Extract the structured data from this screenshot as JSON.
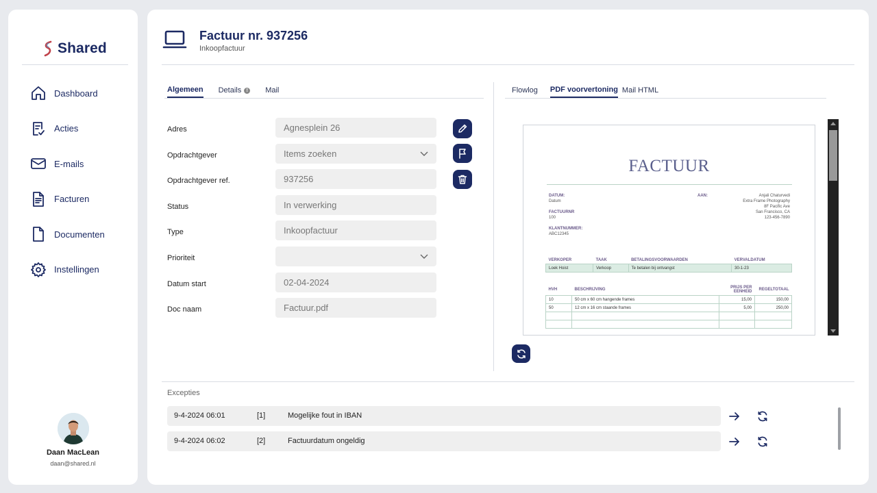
{
  "app": {
    "name": "Shared"
  },
  "sidebar": {
    "items": [
      {
        "label": "Dashboard",
        "icon": "home-icon"
      },
      {
        "label": "Acties",
        "icon": "tasks-icon"
      },
      {
        "label": "E-mails",
        "icon": "mail-icon"
      },
      {
        "label": "Facturen",
        "icon": "invoice-icon"
      },
      {
        "label": "Documenten",
        "icon": "document-icon"
      },
      {
        "label": "Instellingen",
        "icon": "gear-icon"
      }
    ],
    "user": {
      "name": "Daan MacLean",
      "email": "daan@shared.nl"
    }
  },
  "header": {
    "title": "Factuur nr. 937256",
    "subtitle": "Inkoopfactuur"
  },
  "left_tabs": [
    {
      "label": "Algemeen",
      "active": true
    },
    {
      "label": "Details",
      "active": false
    },
    {
      "label": "Mail",
      "active": false
    }
  ],
  "right_tabs": [
    {
      "label": "Flowlog",
      "active": false
    },
    {
      "label": "PDF voorvertoning",
      "active": true
    },
    {
      "label": "Mail HTML",
      "active": false
    }
  ],
  "form": {
    "fields": [
      {
        "label": "Adres",
        "value": "Agnesplein 26"
      },
      {
        "label": "Opdrachtgever",
        "value": "Items zoeken",
        "type": "select"
      },
      {
        "label": "Opdrachtgever ref.",
        "value": "937256"
      },
      {
        "label": "Status",
        "value": "In verwerking"
      },
      {
        "label": "Type",
        "value": "Inkoopfactuur"
      },
      {
        "label": "Prioriteit",
        "value": "",
        "type": "select"
      },
      {
        "label": "Datum start",
        "value": "02-04-2024"
      },
      {
        "label": "Doc naam",
        "value": "Factuur.pdf"
      }
    ]
  },
  "pdf": {
    "title": "FACTUUR",
    "left_block": {
      "datum_label": "DATUM:",
      "datum_value": "Datum",
      "factuurnr_label": "FACTUURNR",
      "factuurnr_value": "100",
      "klantnummer_label": "KLANTNUMMER:",
      "klantnummer_value": "ABC12345"
    },
    "aan_label": "AAN:",
    "recipient": [
      "Anjali Chaturvedi",
      "Extra Frame Photography",
      "8F Pacific Ave",
      "San Francisco, CA",
      "123-456-7890"
    ],
    "table1": {
      "headers": [
        "VERKOPER",
        "TAAK",
        "BETALINGSVOORWAARDEN",
        "VERVALDATUM"
      ],
      "row": [
        "Loek Hoist",
        "Verkoop",
        "Te betalen bij ontvangst",
        "30-1-23"
      ]
    },
    "table2": {
      "headers": [
        "HVH",
        "BESCHRIJVING",
        "PRIJS PER EENHEID",
        "REGELTOTAAL"
      ],
      "rows": [
        [
          "10",
          "50 cm x 60 cm hangende frames",
          "15,00",
          "150,00"
        ],
        [
          "50",
          "12 cm x 16 cm staande frames",
          "5,00",
          "250,00"
        ],
        [
          "",
          "",
          "",
          ""
        ],
        [
          "",
          "",
          "",
          ""
        ]
      ]
    }
  },
  "exceptions": {
    "label": "Excepties",
    "items": [
      {
        "date": "9-4-2024 06:01",
        "code": "[1]",
        "message": "Mogelijke fout in IBAN"
      },
      {
        "date": "9-4-2024 06:02",
        "code": "[2]",
        "message": "Factuurdatum ongeldig"
      }
    ]
  },
  "colors": {
    "navy": "#1c2a63",
    "field": "#efefef",
    "background": "#e8eaee"
  }
}
